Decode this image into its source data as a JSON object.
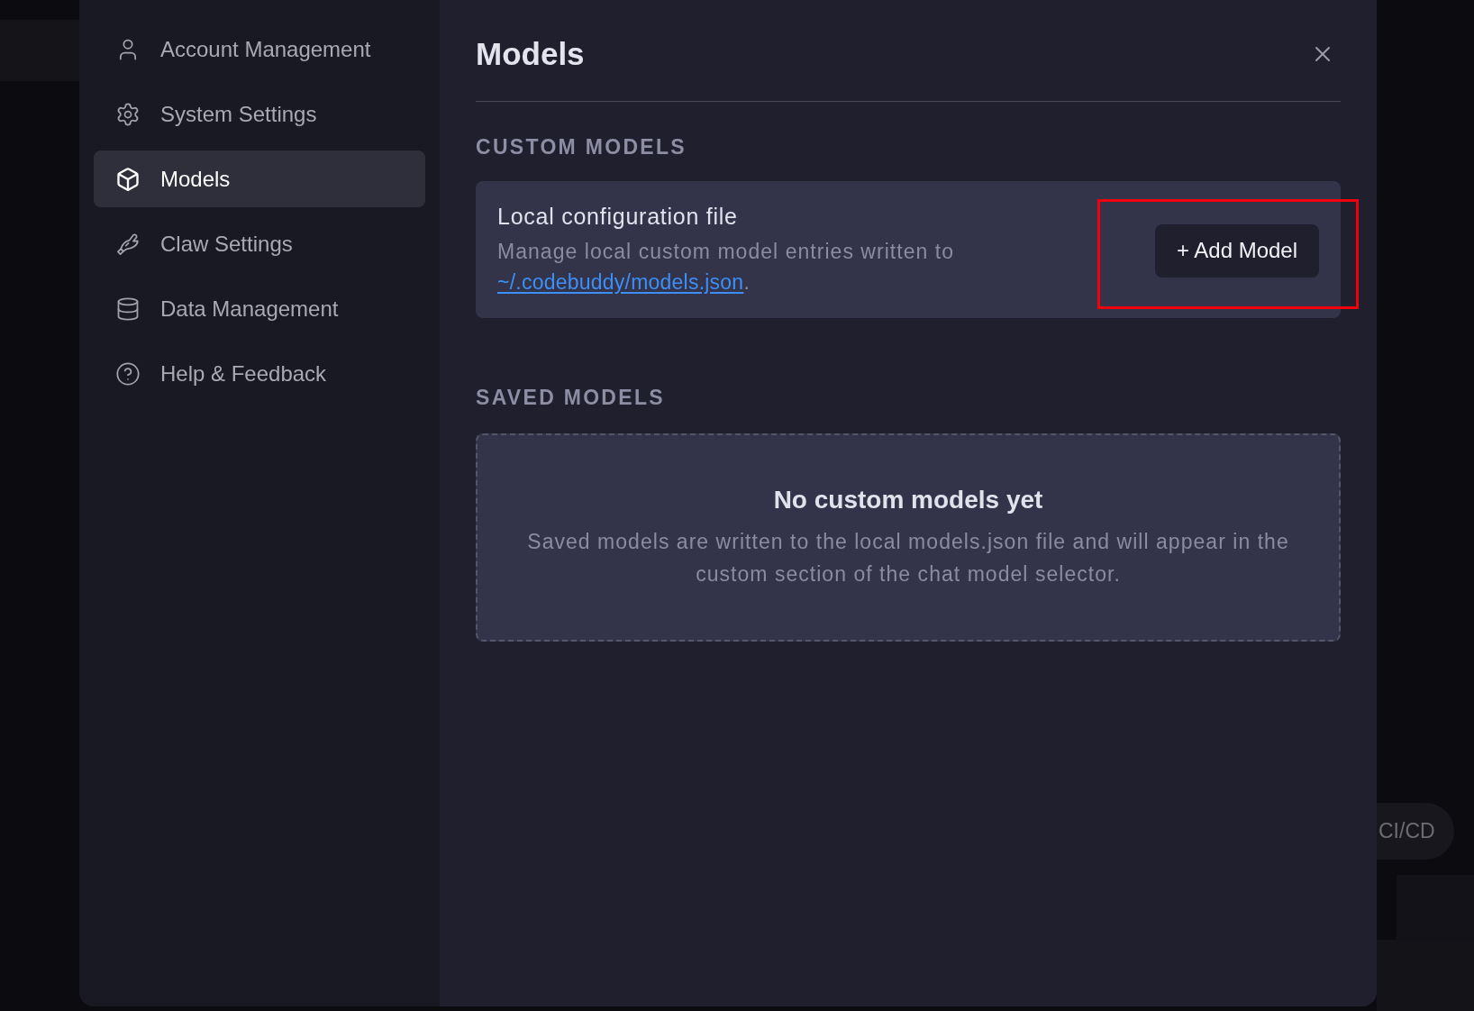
{
  "sidebar": {
    "items": [
      {
        "label": "Account Management",
        "selected": false
      },
      {
        "label": "System Settings",
        "selected": false
      },
      {
        "label": "Models",
        "selected": true
      },
      {
        "label": "Claw Settings",
        "selected": false
      },
      {
        "label": "Data Management",
        "selected": false
      },
      {
        "label": "Help & Feedback",
        "selected": false
      }
    ]
  },
  "dialog": {
    "title": "Models"
  },
  "sections": [
    {
      "kind": "config",
      "heading": "CUSTOM MODELS",
      "card": {
        "title": "Local configuration file",
        "description": "Manage local custom model entries written to",
        "link": "~/.codebuddy/models.json",
        "after_link": "."
      },
      "button": {
        "label": "+ Add Model",
        "highlighted": true
      }
    },
    {
      "kind": "empty",
      "heading": "SAVED MODELS",
      "empty_state": {
        "title": "No custom models yet",
        "message": "Saved models are written to the local models.json file and will appear in the custom section of the chat model selector."
      }
    }
  ],
  "background": {
    "chip": "CI/CD"
  }
}
